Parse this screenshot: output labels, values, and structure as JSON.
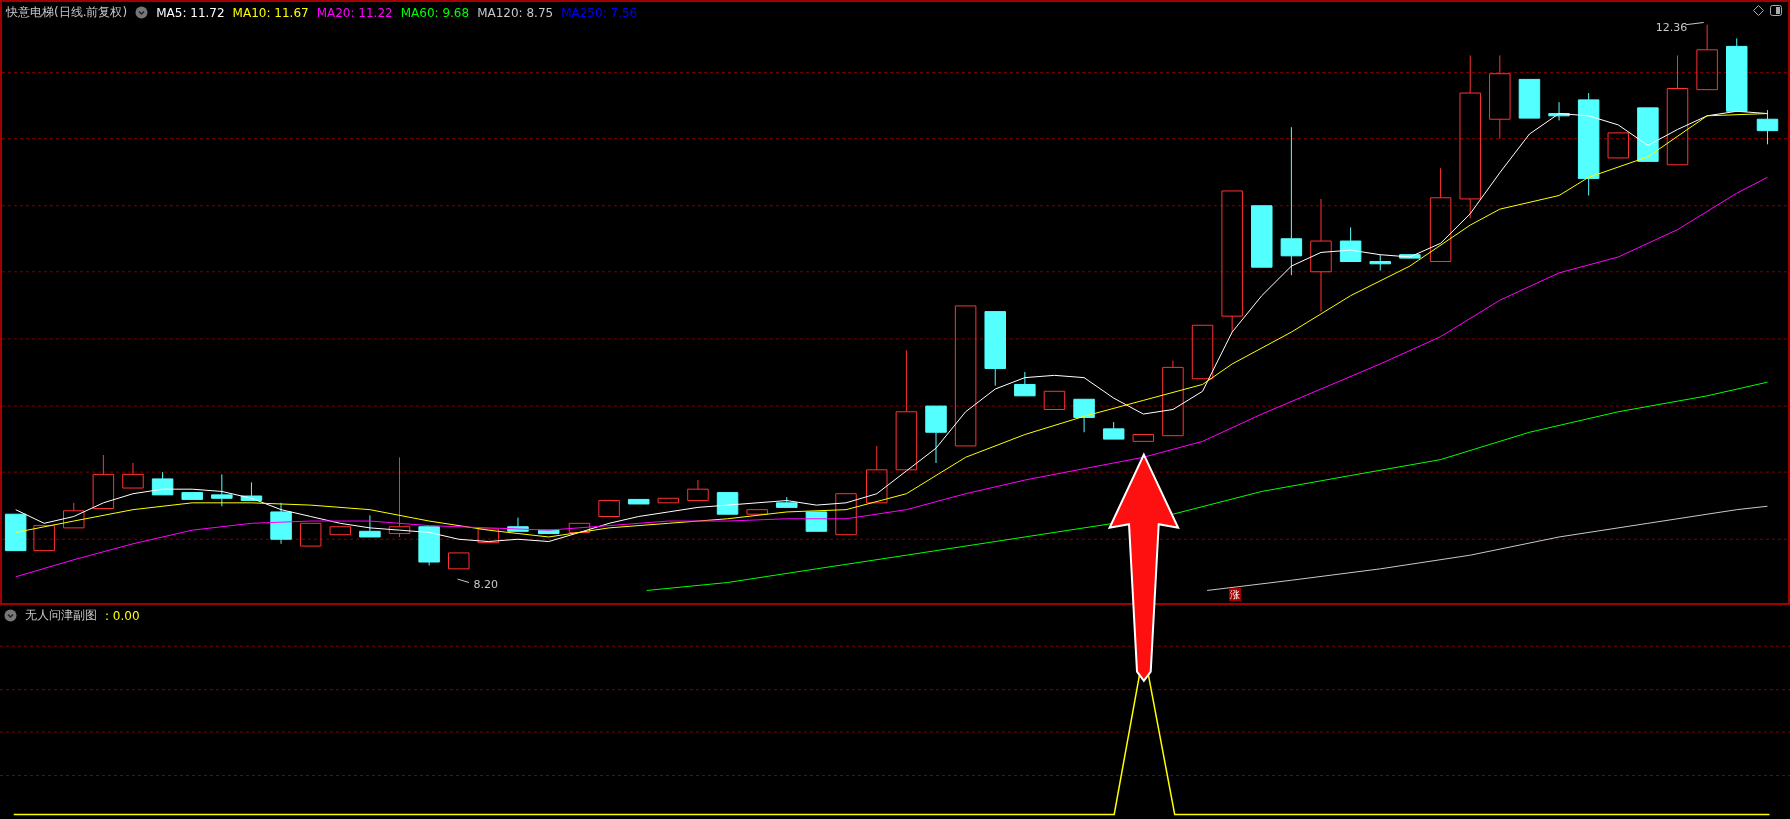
{
  "main_chart": {
    "title": "快意电梯(日线.前复权)",
    "indicators": [
      {
        "label": "MA5: 11.72",
        "color": "#ffffff"
      },
      {
        "label": "MA10: 11.67",
        "color": "#ffff00"
      },
      {
        "label": "MA20: 11.22",
        "color": "#ff00ff"
      },
      {
        "label": "MA60: 9.68",
        "color": "#00ff00"
      },
      {
        "label": "MA120: 8.75",
        "color": "#c8c8c8"
      },
      {
        "label": "MA250: 7.56",
        "color": "#0000ff"
      }
    ],
    "high_label": "12.36",
    "low_label": "8.20",
    "badge": "涨"
  },
  "sub_chart": {
    "title": "无人问津副图",
    "value": ": 0.00"
  }
}
